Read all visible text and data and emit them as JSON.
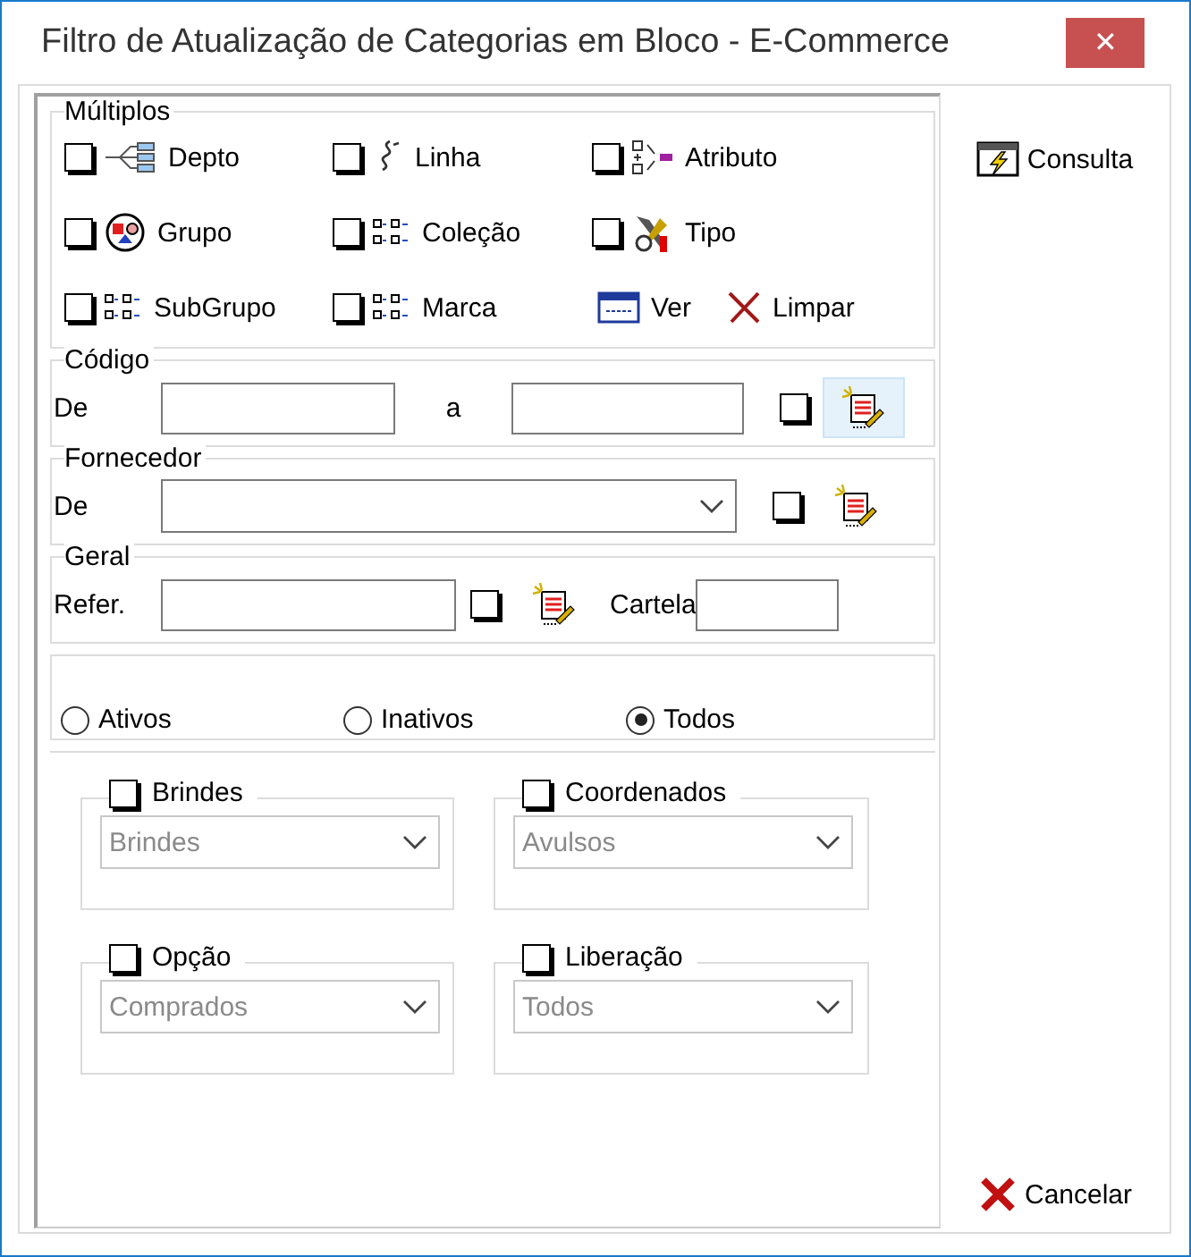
{
  "window": {
    "title": "Filtro de Atualização de Categorias em Bloco - E-Commerce",
    "close": "✕"
  },
  "multiplos": {
    "title": "Múltiplos",
    "items": [
      {
        "kind": "checkbox",
        "label": "Depto",
        "checked": false
      },
      {
        "kind": "checkbox",
        "label": "Linha",
        "checked": false
      },
      {
        "kind": "checkbox",
        "label": "Atributo",
        "checked": false
      },
      {
        "kind": "checkbox",
        "label": "Grupo",
        "checked": false
      },
      {
        "kind": "checkbox",
        "label": "Coleção",
        "checked": false
      },
      {
        "kind": "checkbox",
        "label": "Tipo",
        "checked": false
      },
      {
        "kind": "checkbox",
        "label": "SubGrupo",
        "checked": false
      },
      {
        "kind": "checkbox",
        "label": "Marca",
        "checked": false
      },
      {
        "kind": "button",
        "label": "Ver"
      },
      {
        "kind": "button",
        "label": "Limpar"
      }
    ]
  },
  "codigo": {
    "title": "Código",
    "from_label": "De",
    "to_label": "a",
    "checked": false
  },
  "fornecedor": {
    "title": "Fornecedor",
    "label": "De",
    "checked": false
  },
  "geral": {
    "title": "Geral",
    "label": "Refer.",
    "checked": false,
    "cartela_label": "Cartela"
  },
  "status": [
    {
      "label": "Ativos",
      "selected": false
    },
    {
      "label": "Inativos",
      "selected": false
    },
    {
      "label": "Todos",
      "selected": true
    }
  ],
  "options": [
    {
      "title": "Brindes",
      "checked": false,
      "value": "Brindes",
      "disabled": true
    },
    {
      "title": "Coordenados",
      "checked": false,
      "value": "Avulsos",
      "disabled": true
    },
    {
      "title": "Opção",
      "checked": false,
      "value": "Comprados",
      "disabled": true
    },
    {
      "title": "Liberação",
      "checked": false,
      "value": "Todos",
      "disabled": true
    }
  ],
  "buttons": [
    {
      "label": "Consulta"
    },
    {
      "label": "Cancelar"
    }
  ]
}
